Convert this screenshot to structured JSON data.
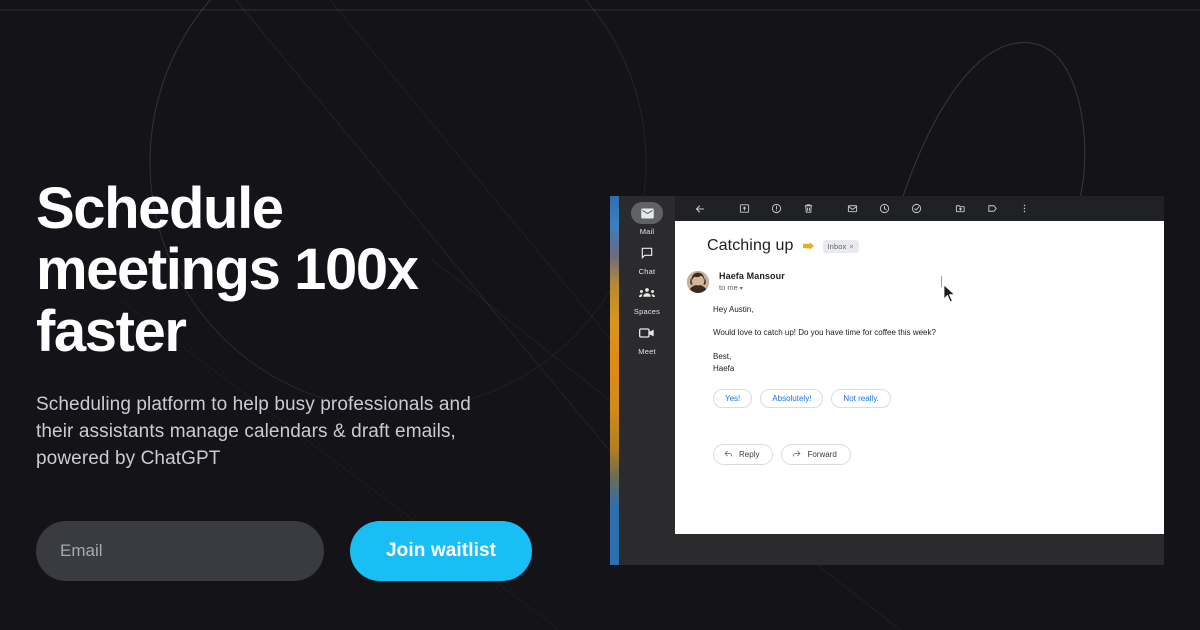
{
  "theme": {
    "page_bg": "#131318",
    "accent": "#19BEF5",
    "heading_color": "#ffffff",
    "sub_color": "#c9ccd2",
    "input_bg": "#3a3b41",
    "mail_toolbar_bg": "#202124",
    "mail_rail_bg": "#2b2b2e",
    "label_chip_color": "#E8B020",
    "smart_reply_color": "#1a73e8"
  },
  "hero": {
    "headline": "Schedule\nmeetings 100x\nfaster",
    "subtitle": "Scheduling platform to help busy professionals and\ntheir assistants manage calendars & draft emails,\npowered by ChatGPT",
    "email_placeholder": "Email",
    "email_value": "",
    "cta_label": "Join waitlist"
  },
  "mail": {
    "rail": [
      {
        "label": "Mail",
        "icon": "mail-icon",
        "active": true
      },
      {
        "label": "Chat",
        "icon": "chat-icon",
        "active": false
      },
      {
        "label": "Spaces",
        "icon": "spaces-icon",
        "active": false
      },
      {
        "label": "Meet",
        "icon": "meet-icon",
        "active": false
      }
    ],
    "toolbar": [
      {
        "name": "back-icon",
        "title": "Back to Inbox"
      },
      {
        "name": "archive-icon",
        "title": "Archive"
      },
      {
        "name": "report-spam-icon",
        "title": "Report spam"
      },
      {
        "name": "delete-icon",
        "title": "Delete"
      },
      {
        "name": "mark-unread-icon",
        "title": "Mark as unread"
      },
      {
        "name": "snooze-icon",
        "title": "Snooze"
      },
      {
        "name": "add-to-tasks-icon",
        "title": "Add to Tasks"
      },
      {
        "name": "move-to-icon",
        "title": "Move to"
      },
      {
        "name": "labels-icon",
        "title": "Labels"
      },
      {
        "name": "more-icon",
        "title": "More"
      }
    ],
    "subject": "Catching up",
    "inbox_label": "Inbox",
    "inbox_label_close": "×",
    "sender_name": "Haefa Mansour",
    "sender_to": "to me",
    "sender_caret": "▾",
    "body_greeting": "Hey Austin,",
    "body_paragraph": "Would love to catch up! Do you have time for coffee this week?",
    "body_signoff": "Best,",
    "body_signature": "Haefa",
    "smart_replies": [
      "Yes!",
      "Absolutely!",
      "Not really."
    ],
    "reply_label": "Reply",
    "forward_label": "Forward"
  }
}
